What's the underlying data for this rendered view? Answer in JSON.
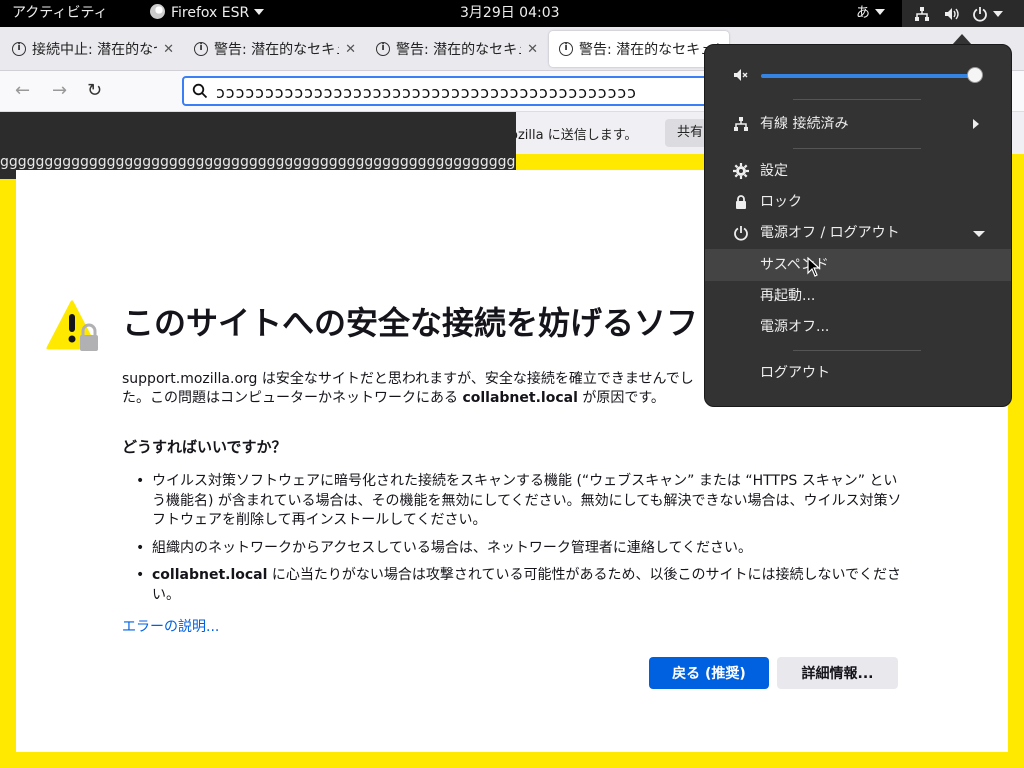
{
  "topbar": {
    "activities": "アクティビティ",
    "app_name": "Firefox ESR",
    "clock": "3月29日  04:03",
    "ime": "あ"
  },
  "tabs": [
    {
      "title": "接続中止: 潜在的なセキュリティ",
      "icon": "info-icon"
    },
    {
      "title": "警告: 潜在的なセキュリティ",
      "icon": "info-icon"
    },
    {
      "title": "警告: 潜在的なセキュリティ",
      "icon": "info-icon"
    },
    {
      "title": "警告: 潜在的なセキュリティ",
      "icon": "info-icon"
    }
  ],
  "urlbar": {
    "value": "ɔɔɔɔɔɔɔɔɔɔɔɔɔɔɔɔɔɔɔɔɔɔɔɔɔɔɔɔɔɔɔɔɔɔɔɔɔɔɔɔɔɔɔ"
  },
  "notification": {
    "text": "ozilla に送信します。",
    "share_label": "共有"
  },
  "dropdown_text": "gggggggggggggggggggggggggggggggggggggggggggggggggggggggggggggggggg",
  "error_page": {
    "title": "このサイトへの安全な接続を妨げるソフトウェア",
    "desc_part1": "support.mozilla.org は安全なサイトだと思われますが、安全な接続を確立できませんでした。この問題はコンピューターかネットワークにある ",
    "desc_host": "collabnet.local",
    "desc_part2": " が原因です。",
    "howto": "どうすればいいですか？",
    "tip1": "ウイルス対策ソフトウェアに暗号化された接続をスキャンする機能 (“ウェブスキャン” または “HTTPS スキャン” という機能名) が含まれている場合は、その機能を無効にしてください。無効にしても解決できない場合は、ウイルス対策ソフトウェアを削除して再インストールしてください。",
    "tip2": "組織内のネットワークからアクセスしている場合は、ネットワーク管理者に連絡してください。",
    "tip3_host": "collabnet.local",
    "tip3_rest": " に心当たりがない場合は攻撃されている可能性があるため、以後このサイトには接続しないでください。",
    "learn_more": "エラーの説明...",
    "back_button": "戻る (推奨)",
    "advanced_button": "詳細情報..."
  },
  "system_menu": {
    "volume_level": 1.0,
    "network_label": "有線 接続済み",
    "settings_label": "設定",
    "lock_label": "ロック",
    "power_label": "電源オフ / ログアウト",
    "suspend_label": "サスペンド",
    "restart_label": "再起動...",
    "poweroff_label": "電源オフ...",
    "logout_label": "ログアウト"
  },
  "colors": {
    "accent": "#3584e4",
    "firefox_blue": "#0061e0",
    "warning_yellow": "#ffe900"
  }
}
